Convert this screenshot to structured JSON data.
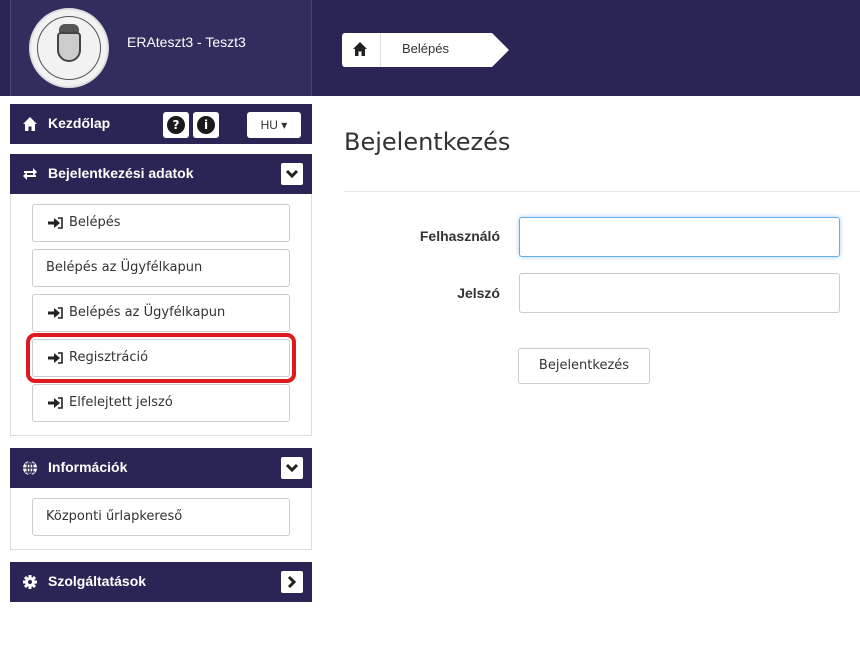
{
  "app": {
    "title": "ERAteszt3 - Teszt3"
  },
  "breadcrumb": {
    "home_icon": "home-icon",
    "current": "Belépés"
  },
  "sidebar": {
    "home": {
      "label": "Kezdőlap",
      "help_icon": "question-circle-icon",
      "info_icon": "info-circle-icon",
      "language": "HU ▾"
    },
    "panels": [
      {
        "title": "Bejelentkezési adatok",
        "icon": "exchange-icon",
        "toggle_icon": "chevron-down-icon",
        "items": [
          {
            "label": "Belépés",
            "icon": "sign-in-icon"
          },
          {
            "label": "Belépés az Ügyfélkapun",
            "icon": ""
          },
          {
            "label": "Belépés az Ügyfélkapun",
            "icon": "sign-in-icon"
          },
          {
            "label": "Regisztráció",
            "icon": "sign-in-icon",
            "highlighted": true
          },
          {
            "label": "Elfelejtett jelszó",
            "icon": "sign-in-icon"
          }
        ]
      },
      {
        "title": "Információk",
        "icon": "globe-icon",
        "toggle_icon": "chevron-down-icon",
        "items": [
          {
            "label": "Központi űrlapkereső"
          }
        ]
      },
      {
        "title": "Szolgáltatások",
        "icon": "gear-icon",
        "toggle_icon": "chevron-right-icon"
      }
    ]
  },
  "main": {
    "title": "Bejelentkezés",
    "fields": {
      "username_label": "Felhasználó",
      "username_value": "",
      "password_label": "Jelszó",
      "password_value": ""
    },
    "submit_label": "Bejelentkezés"
  },
  "colors": {
    "header_bg": "#2a2555",
    "highlight": "#e0191f",
    "focus": "#66afe9"
  }
}
